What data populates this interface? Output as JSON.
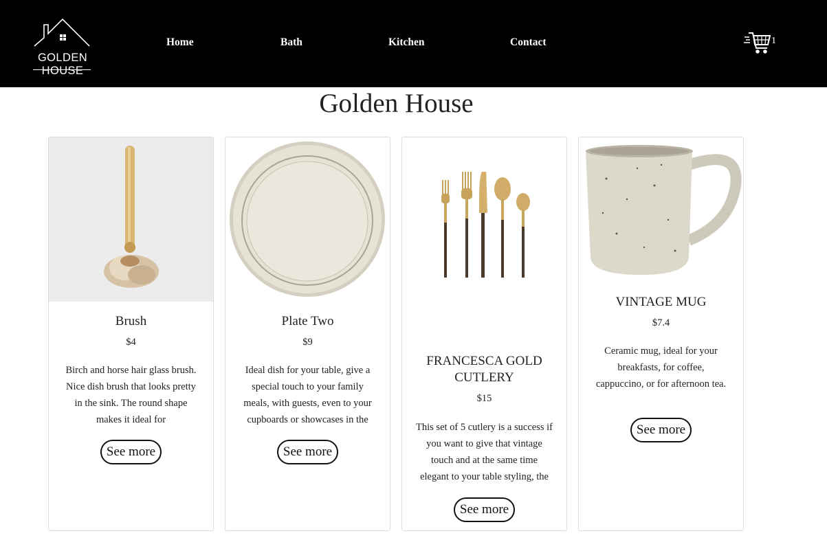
{
  "brand": {
    "name": "GOLDEN HOUSE"
  },
  "nav": {
    "home": "Home",
    "bath": "Bath",
    "kitchen": "Kitchen",
    "contact": "Contact"
  },
  "cart": {
    "count": "1",
    "icon": "shopping-cart-icon"
  },
  "page": {
    "title": "Golden House"
  },
  "products": [
    {
      "name": "Brush",
      "price": "$4",
      "description": "Birch and horse hair glass brush. Nice dish brush that looks pretty in the sink. The round shape makes it ideal for",
      "button": "See more",
      "image": "brush-image"
    },
    {
      "name": "Plate Two",
      "price": "$9",
      "description": "Ideal dish for your table, give a special touch to your family meals, with guests, even to your cupboards or showcases in the",
      "button": "See more",
      "image": "plate-image"
    },
    {
      "name": "FRANCESCA GOLD CUTLERY",
      "price": "$15",
      "description": "This set of 5 cutlery is a success if you want to give that vintage touch and at the same time elegant to your table styling, the",
      "button": "See more",
      "image": "cutlery-image"
    },
    {
      "name": "VINTAGE MUG",
      "price": "$7.4",
      "description": "Ceramic mug, ideal for your breakfasts, for coffee, cappuccino, or for afternoon tea.",
      "button": "See more",
      "image": "mug-image"
    }
  ],
  "colors": {
    "navbar": "#000000",
    "background": "#ffffff",
    "text": "#222222",
    "card_border": "#dcdcdc"
  }
}
